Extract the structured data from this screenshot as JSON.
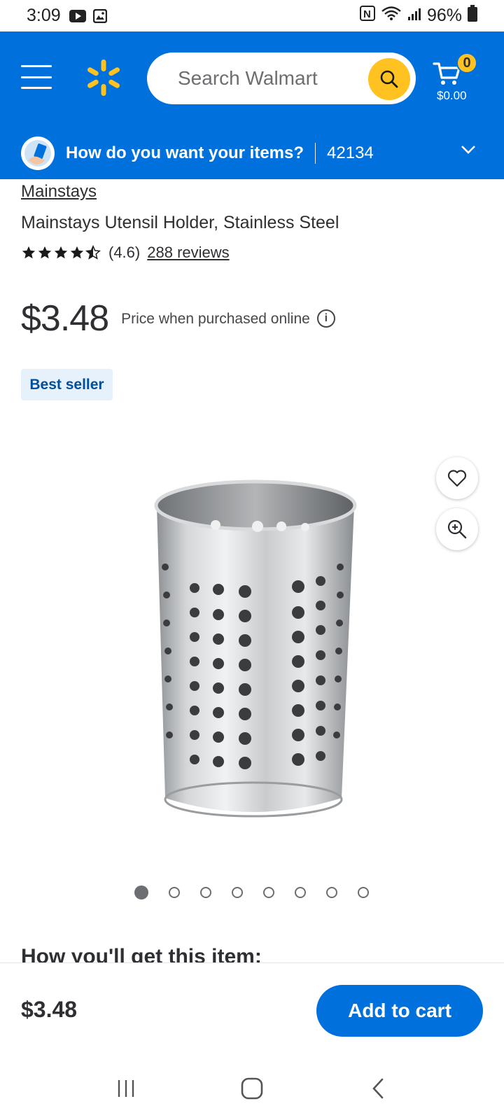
{
  "status_bar": {
    "time": "3:09",
    "battery": "96%"
  },
  "header": {
    "search_placeholder": "Search Walmart",
    "cart_count": "0",
    "cart_total": "$0.00"
  },
  "delivery": {
    "question": "How do you want your items?",
    "zip": "42134"
  },
  "product": {
    "brand": "Mainstays",
    "title": "Mainstays Utensil Holder, Stainless Steel",
    "rating_value": "(4.6)",
    "rating": 4.6,
    "reviews": "288 reviews",
    "price": "$3.48",
    "price_note": "Price when purchased online",
    "badge": "Best seller",
    "image_count": 8,
    "active_image": 1
  },
  "section": {
    "how_heading": "How you'll get this item:"
  },
  "bottom_bar": {
    "price": "$3.48",
    "add_to_cart": "Add to cart"
  },
  "colors": {
    "brand_blue": "#0071dc",
    "spark_yellow": "#ffc220"
  }
}
